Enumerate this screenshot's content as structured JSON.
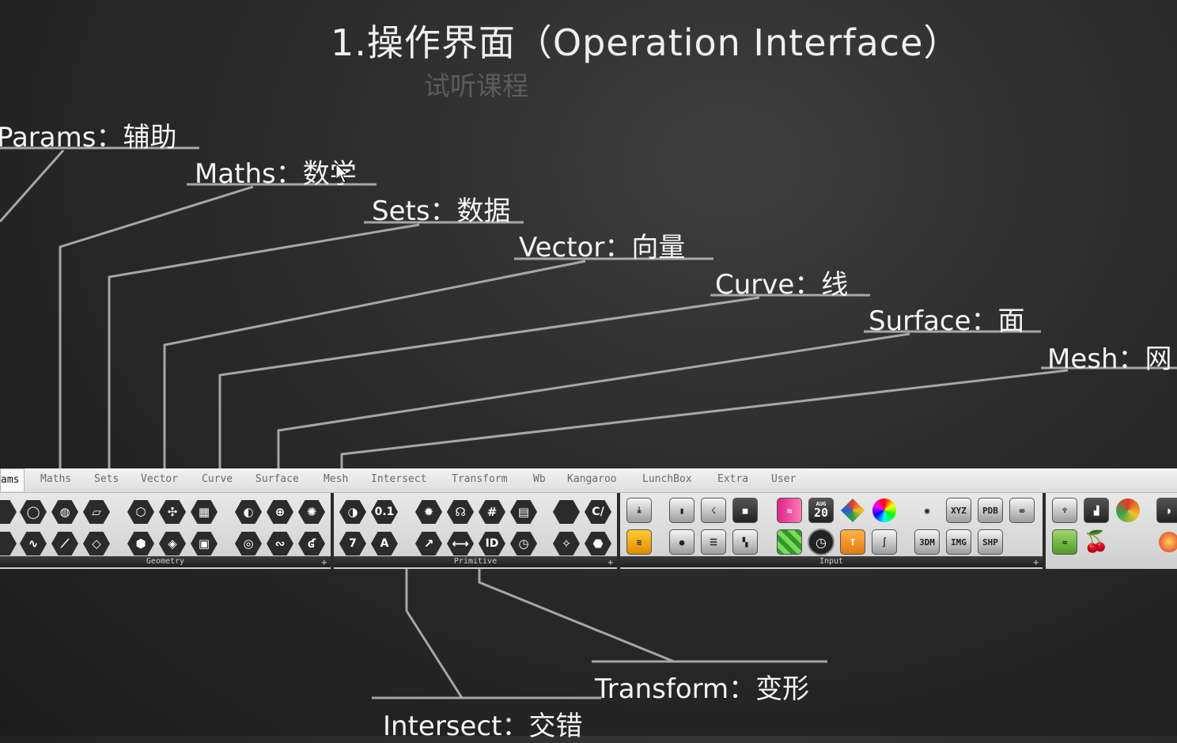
{
  "slide": {
    "title": "1.操作界面（Operation Interface）",
    "subtitle": "试听课程"
  },
  "callouts": {
    "params": "Params：辅助",
    "maths": "Maths：数学",
    "sets": "Sets：数据",
    "vector": "Vector：向量",
    "curve": "Curve：线",
    "surface": "Surface：面",
    "mesh": "Mesh：网",
    "transform": "Transform：变形",
    "intersect": "Intersect：交错"
  },
  "toolbar": {
    "tabs": [
      "ams",
      "Maths",
      "Sets",
      "Vector",
      "Curve",
      "Surface",
      "Mesh",
      "Intersect",
      "Transform",
      "Wb",
      "Kangaroo",
      "LunchBox",
      "Extra",
      "User"
    ],
    "active_tab": "ams",
    "groups": {
      "geometry": "Geometry",
      "primitive": "Primitive",
      "input": "Input"
    },
    "icon_labels": {
      "decimal": "0.1",
      "seven": "7",
      "letter_a": "A",
      "id": "ID",
      "text": "C/",
      "calendar_month": "AUG",
      "calendar_day": "20",
      "xyz": "XYZ",
      "pdb": "PDB",
      "import_3dm": "3DM",
      "import_img": "IMG",
      "import_shp": "SHP"
    }
  }
}
